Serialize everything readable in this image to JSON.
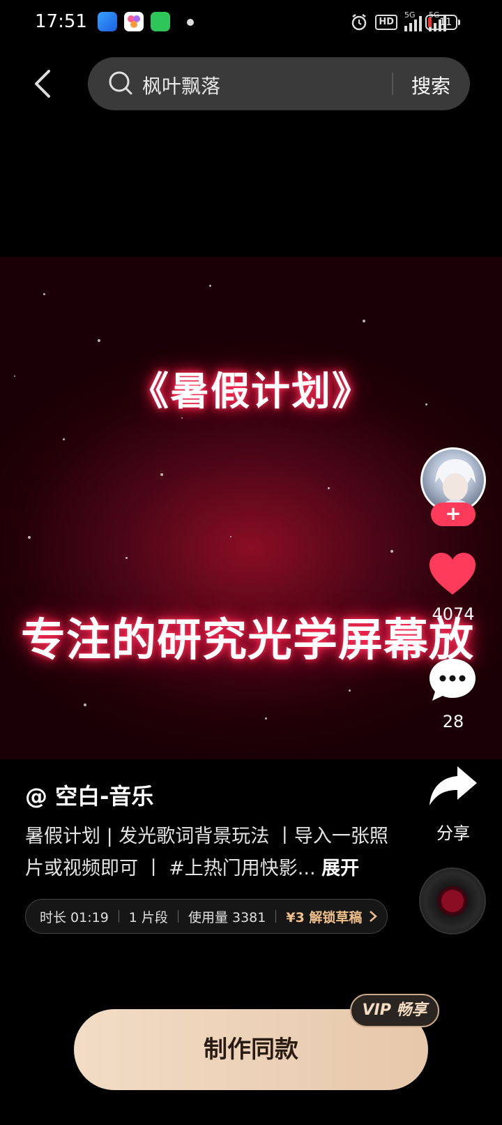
{
  "status_bar": {
    "time": "17:51",
    "network_1": "5G",
    "network_2": "5G",
    "hd_label": "HD",
    "battery": "11"
  },
  "header": {
    "search_text": "枫叶飘落",
    "search_button": "搜索"
  },
  "video": {
    "title": "《暑假计划》",
    "lyric": "专注的研究光学屏幕放"
  },
  "rail": {
    "like_count": "4074",
    "comment_count": "28",
    "share_label": "分享",
    "follow_label": "+"
  },
  "info": {
    "author": "@ 空白-音乐",
    "description": "暑假计划 | 发光歌词背景玩法 丨导入一张照片或视频即可 丨 #上热门用快影...",
    "expand_label": "展开",
    "meta": {
      "duration": "时长 01:19",
      "segments": "1 片段",
      "usage": "使用量 3381",
      "unlock": "¥3 解锁草稿"
    }
  },
  "bottom": {
    "vip_badge": "VIP 畅享",
    "make_button": "制作同款"
  }
}
